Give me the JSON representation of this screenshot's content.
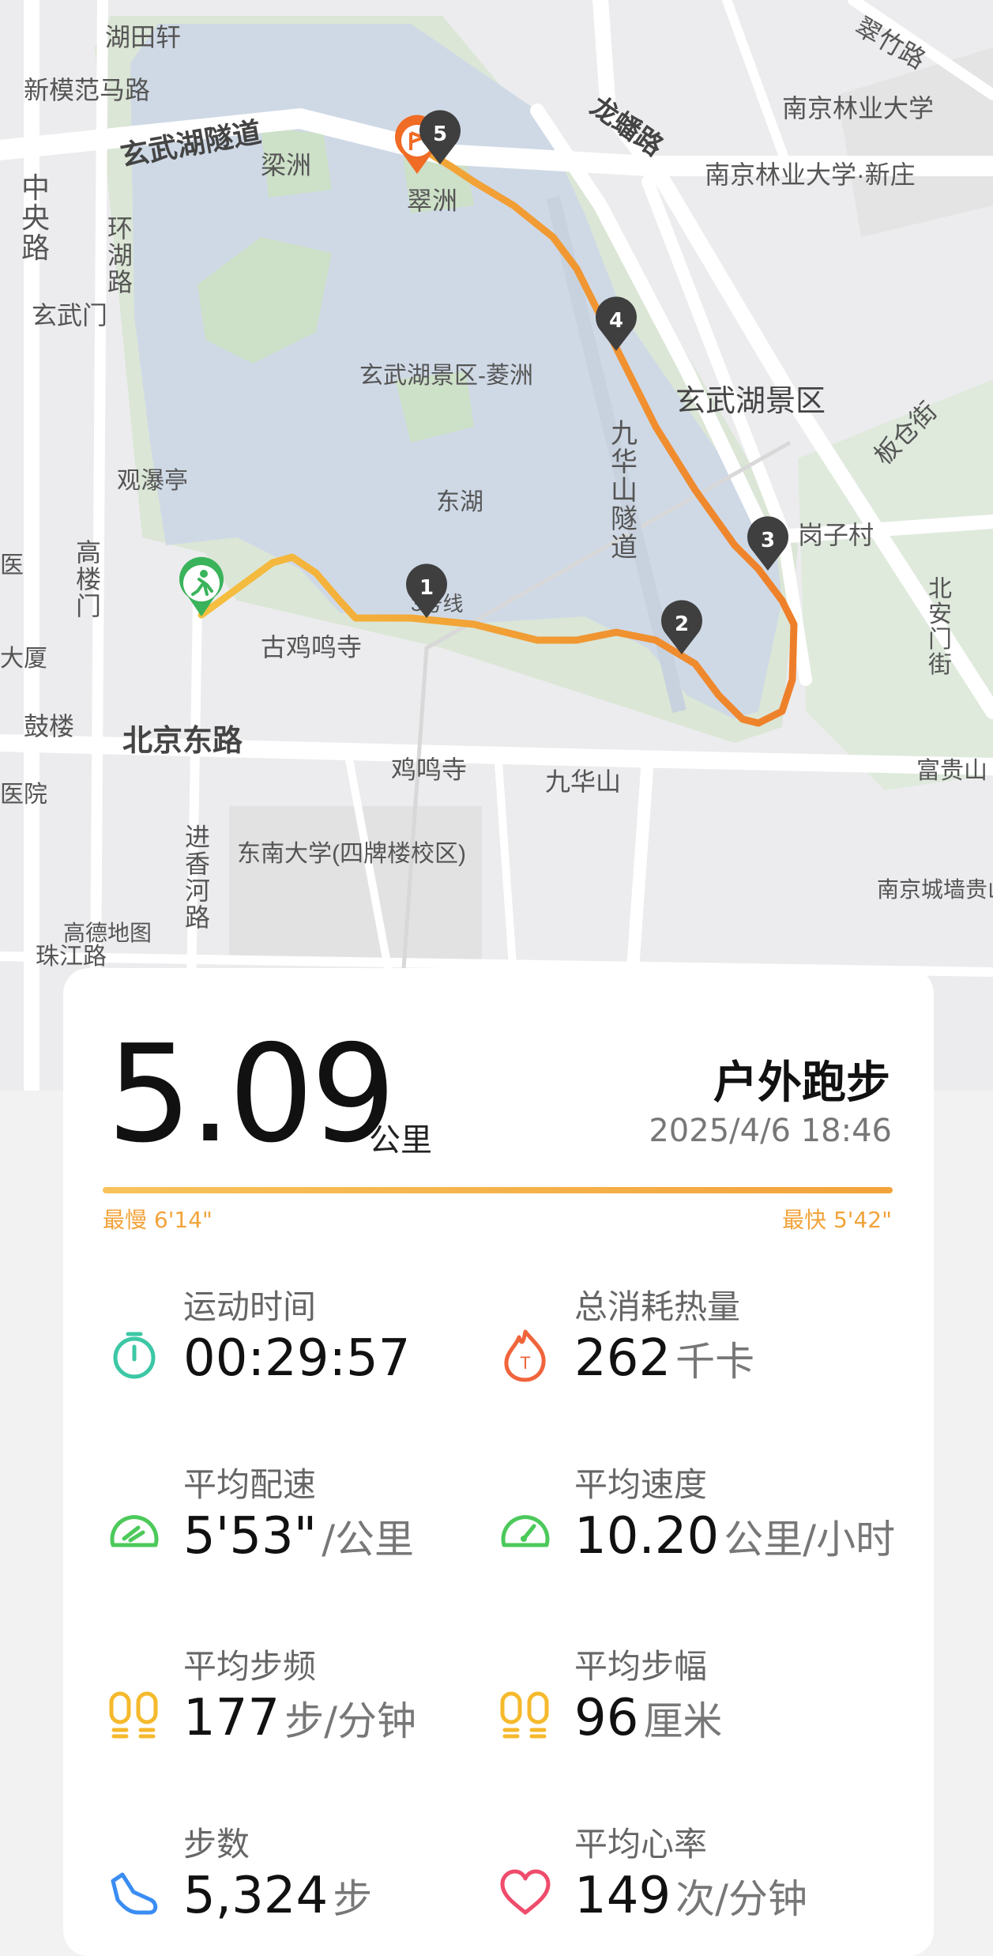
{
  "map": {
    "labels": {
      "hutianxuan": "湖田轩",
      "xinmofanmalu": "新模范马路",
      "xuanwuhu_tunnel": "玄武湖隧道",
      "liangzhou": "梁洲",
      "cuizhou": "翠洲",
      "longpanlu": "龙蟠路",
      "nanjing_forestry": "南京林业大学",
      "nanjing_forestry_xz": "南京林业大学·新庄",
      "cuizhulu": "翠竹路",
      "zhongyanglu": "中央路",
      "huanhulu": "环湖路",
      "xuanwumen": "玄武门",
      "lingzhou": "玄武湖景区-菱洲",
      "guanpuiting": "观瀑亭",
      "donghu": "东湖",
      "xuanwu_scenic": "玄武湖景区",
      "jiuhuashan_tunnel": "九华山隧道",
      "gangzicun": "岗子村",
      "bancangjie": "板仓街",
      "gaoloumen": "高楼门",
      "line_label": "3号线",
      "gujimingsi": "古鸡鸣寺",
      "beianmenjie": "北安门街",
      "da_sha": "大厦",
      "gulou": "鼓楼",
      "beijingdonglu": "北京东路",
      "jimingsi": "鸡鸣寺",
      "jiuhuashan": "九华山",
      "fuguishan": "富贵山",
      "hospital": "医院",
      "jinxianghelu": "进香河路",
      "seu": "东南大学(四牌楼校区)",
      "gaoshang": "高德地图",
      "zhujianglu": "珠江路",
      "nanjing_city_wall": "南京城墙贵山登城",
      "yi": "医"
    },
    "markers": [
      "1",
      "2",
      "3",
      "4",
      "5"
    ],
    "start_icon": "runner-start-icon",
    "end_icon": "flag-end-icon",
    "route_colors": {
      "start": "#f5c040",
      "end": "#ee7f2a"
    }
  },
  "summary": {
    "distance": "5.09",
    "distance_unit": "公里",
    "activity_type": "户外跑步",
    "datetime": "2025/4/6 18:46",
    "slowest_pace": "最慢 6'14\"",
    "fastest_pace": "最快 5'42\""
  },
  "stats": {
    "duration": {
      "label": "运动时间",
      "value": "00:29:57",
      "unit": "",
      "icon": "stopwatch-icon",
      "color": "#3cc7a5"
    },
    "calories": {
      "label": "总消耗热量",
      "value": "262",
      "unit": "千卡",
      "icon": "calorie-flame-icon",
      "color": "#f0643c"
    },
    "avg_pace": {
      "label": "平均配速",
      "value": "5'53\"",
      "unit": "/公里",
      "icon": "pace-gauge-icon",
      "color": "#4cc95a"
    },
    "avg_speed": {
      "label": "平均速度",
      "value": "10.20",
      "unit": "公里/小时",
      "icon": "speed-gauge-icon",
      "color": "#4cc95a"
    },
    "cadence": {
      "label": "平均步频",
      "value": "177",
      "unit": "步/分钟",
      "icon": "footprints-icon",
      "color": "#f5b92c"
    },
    "stride": {
      "label": "平均步幅",
      "value": "96",
      "unit": "厘米",
      "icon": "footprints-icon",
      "color": "#f5b92c"
    },
    "steps": {
      "label": "步数",
      "value": "5,324",
      "unit": "步",
      "icon": "shoe-icon",
      "color": "#3a8df2"
    },
    "heart_rate": {
      "label": "平均心率",
      "value": "149",
      "unit": "次/分钟",
      "icon": "heart-icon",
      "color": "#ef4c6c"
    }
  }
}
